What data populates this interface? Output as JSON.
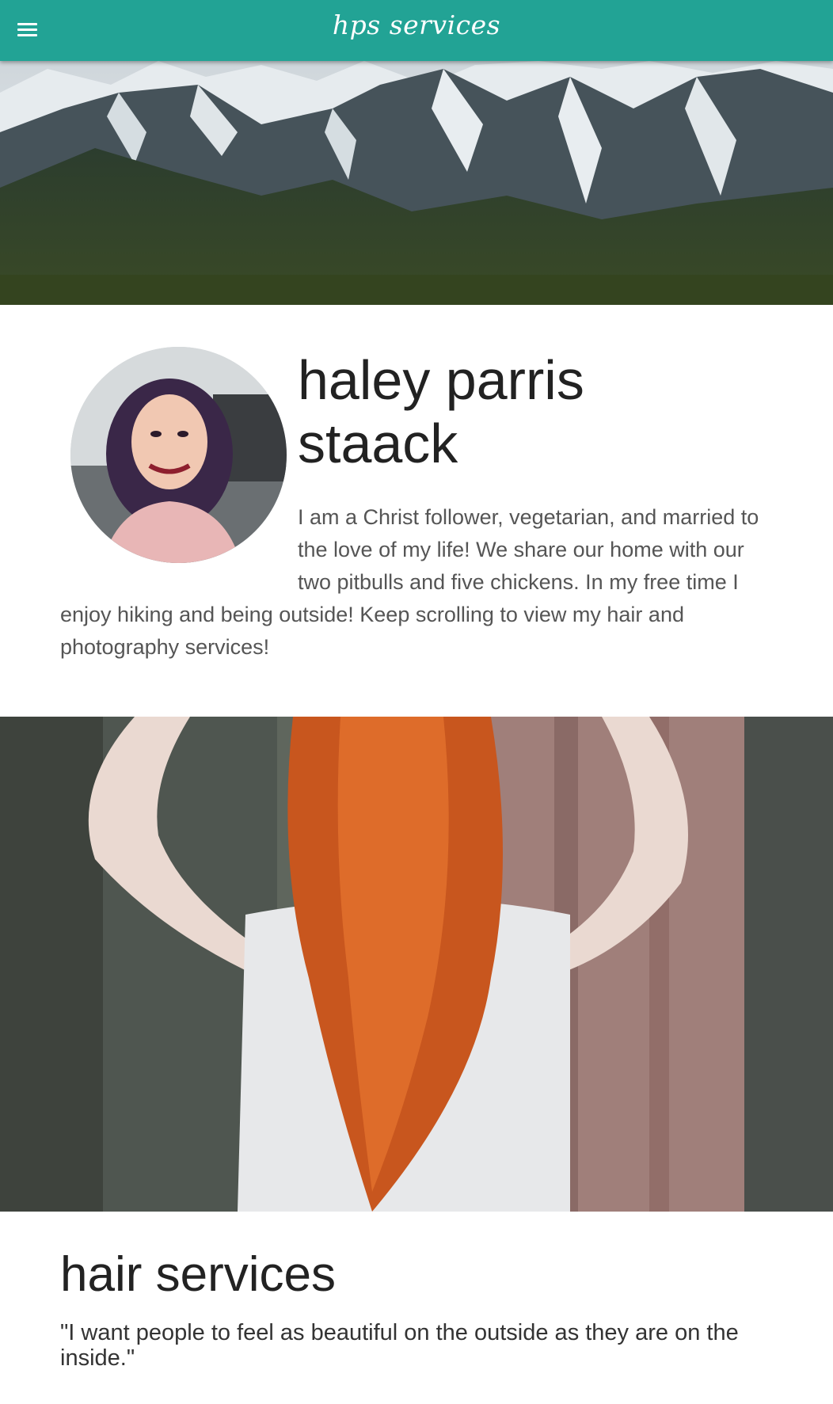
{
  "header": {
    "brand": "hps services",
    "menu_icon": "hamburger-menu-icon",
    "background_color": "#22a395"
  },
  "hero": {
    "image": "snowy-mountain-range-photo"
  },
  "about": {
    "avatar_image": "portrait-photo-woman",
    "name_line1": "haley parris",
    "name_line2": "staack",
    "bio_line1": "I am a Christ follower, vegetarian, and married to",
    "bio_line2": "the love of my life! We share our home with our",
    "bio_line3": "two pitbulls and five chickens. In my free time I",
    "bio_line4": "enjoy hiking and being outside! Keep scrolling to view my hair and",
    "bio_line5": "photography services!"
  },
  "feature_image": "red-haired-woman-photo",
  "hair_services": {
    "title": "hair services",
    "quote": "\"I want people to feel as beautiful on the outside as they are on the inside.\""
  }
}
